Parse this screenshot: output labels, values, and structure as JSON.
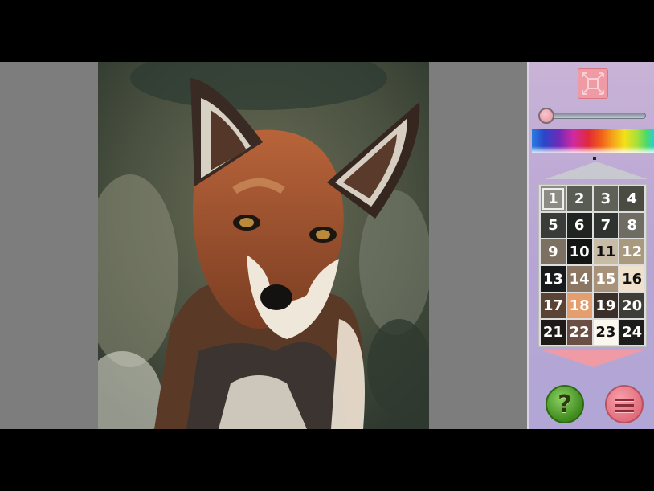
{
  "painting": {
    "subject": "red fox portrait (paint by numbers)"
  },
  "toolbar": {
    "fit_icon": "fit-to-screen-icon",
    "zoom_level": 0.05
  },
  "palette_strip": {
    "icon": "color-spectrum-strip"
  },
  "number_grid": {
    "selected": 1,
    "cells": [
      {
        "label": "1",
        "color": "#8c8c84"
      },
      {
        "label": "2",
        "color": "#595c53"
      },
      {
        "label": "3",
        "color": "#5f6156"
      },
      {
        "label": "4",
        "color": "#4a4c44"
      },
      {
        "label": "5",
        "color": "#3a3d37"
      },
      {
        "label": "6",
        "color": "#202421"
      },
      {
        "label": "7",
        "color": "#2e3330"
      },
      {
        "label": "8",
        "color": "#6f6c63"
      },
      {
        "label": "9",
        "color": "#7b7062"
      },
      {
        "label": "10",
        "color": "#131514"
      },
      {
        "label": "11",
        "color": "#c9bca6"
      },
      {
        "label": "12",
        "color": "#a8997f"
      },
      {
        "label": "13",
        "color": "#17191a"
      },
      {
        "label": "14",
        "color": "#8a7663"
      },
      {
        "label": "15",
        "color": "#a89279"
      },
      {
        "label": "16",
        "color": "#efe1cb"
      },
      {
        "label": "17",
        "color": "#5a4334"
      },
      {
        "label": "18",
        "color": "#e59e6e"
      },
      {
        "label": "19",
        "color": "#3b2f29"
      },
      {
        "label": "20",
        "color": "#3e3e39"
      },
      {
        "label": "21",
        "color": "#1f1a17"
      },
      {
        "label": "22",
        "color": "#6b4f45"
      },
      {
        "label": "23",
        "color": "#fbf7ef"
      },
      {
        "label": "24",
        "color": "#1d1d1b"
      }
    ]
  },
  "buttons": {
    "help_label": "?",
    "help_icon": "help-icon",
    "menu_icon": "menu-icon"
  }
}
